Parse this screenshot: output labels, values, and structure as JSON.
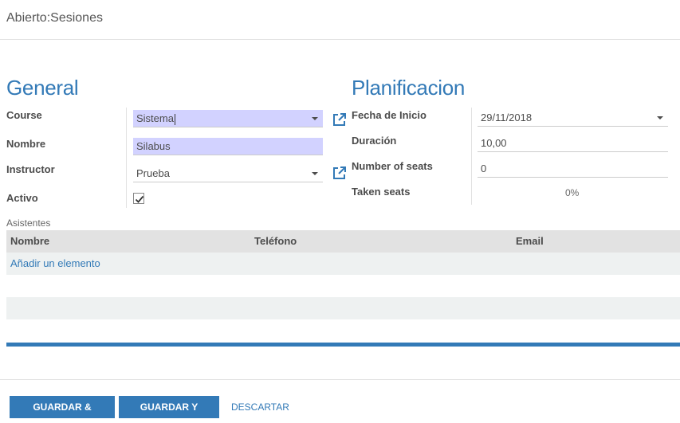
{
  "header": {
    "title": "Abierto:Sesiones"
  },
  "general": {
    "title": "General",
    "course": {
      "label": "Course",
      "value": "Sistema"
    },
    "nombre": {
      "label": "Nombre",
      "value": "Silabus"
    },
    "instructor": {
      "label": "Instructor",
      "value": "Prueba"
    },
    "activo": {
      "label": "Activo",
      "checked": true
    }
  },
  "planificacion": {
    "title": "Planificacion",
    "fecha": {
      "label": "Fecha de Inicio",
      "value": "29/11/2018"
    },
    "duracion": {
      "label": "Duración",
      "value": "10,00"
    },
    "seats": {
      "label": "Number of seats",
      "value": "0"
    },
    "taken": {
      "label": "Taken seats",
      "value": "0%"
    }
  },
  "asistentes": {
    "label": "Asistentes",
    "columns": [
      "Nombre",
      "Teléfono",
      "Email"
    ],
    "add_label": "Añadir un elemento"
  },
  "footer": {
    "save_close": "GUARDAR & CERRAR",
    "save_new": "GUARDAR Y NUEVO",
    "discard": "DESCARTAR"
  },
  "colors": {
    "accent": "#337ab7",
    "required_bg": "#d2d2ff"
  }
}
